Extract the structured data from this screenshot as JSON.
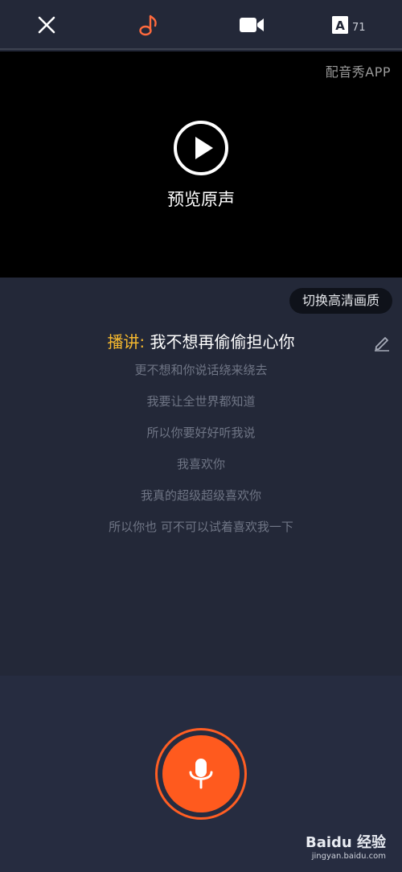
{
  "topbar": {
    "close_icon": "close-icon",
    "music_icon": "music-note-icon",
    "video_icon": "video-camera-icon",
    "text_icon": "font-a-icon",
    "text_count": "71",
    "accent_color": "#ff6a3d"
  },
  "video": {
    "watermark": "配音秀APP",
    "play_label": "预览原声"
  },
  "panel": {
    "quality_label": "切换高清画质",
    "speaker": "播讲:",
    "current_line": " 我不想再偷偷担心你",
    "lyrics": [
      "更不想和你说话绕来绕去",
      "我要让全世界都知道",
      "所以你要好好听我说",
      "我喜欢你",
      "我真的超级超级喜欢你",
      "所以你也 可不可以试着喜欢我一下"
    ]
  },
  "record": {
    "button_color": "#ff5a1e"
  },
  "watermark_baidu": {
    "main": "Baidu 经验",
    "sub": "jingyan.baidu.com"
  }
}
